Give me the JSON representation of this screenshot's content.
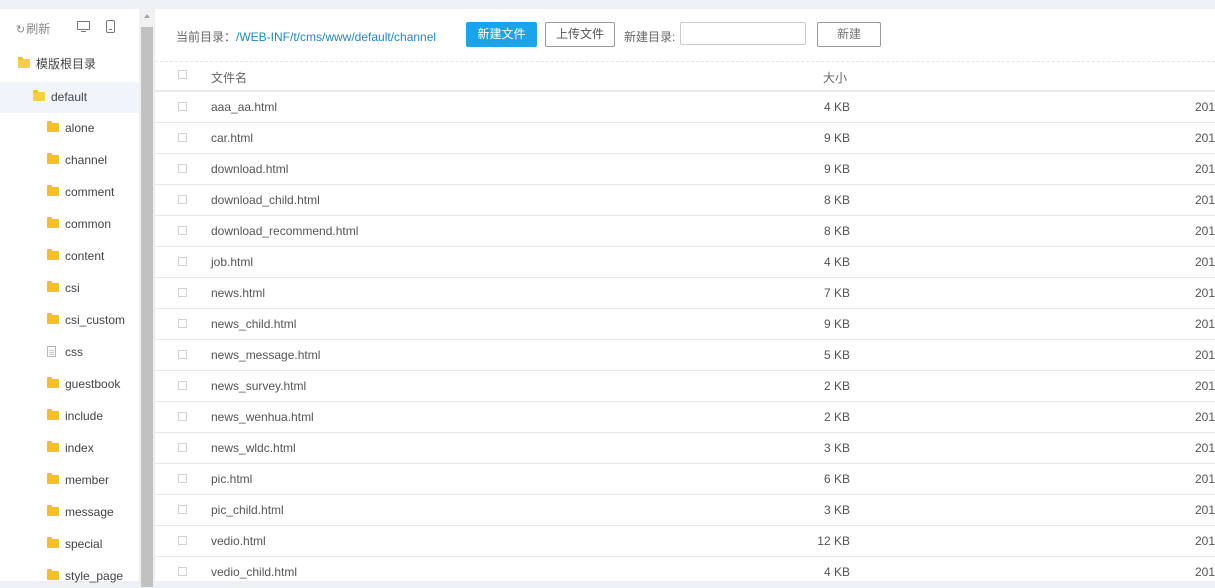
{
  "sidebar": {
    "refresh_label": "刷新",
    "root_label": "模版根目录",
    "selected_label": "default",
    "items": [
      {
        "label": "alone",
        "icon": "folder"
      },
      {
        "label": "channel",
        "icon": "folder"
      },
      {
        "label": "comment",
        "icon": "folder"
      },
      {
        "label": "common",
        "icon": "folder"
      },
      {
        "label": "content",
        "icon": "folder"
      },
      {
        "label": "csi",
        "icon": "folder"
      },
      {
        "label": "csi_custom",
        "icon": "folder"
      },
      {
        "label": "css",
        "icon": "file"
      },
      {
        "label": "guestbook",
        "icon": "folder"
      },
      {
        "label": "include",
        "icon": "folder"
      },
      {
        "label": "index",
        "icon": "folder"
      },
      {
        "label": "member",
        "icon": "folder"
      },
      {
        "label": "message",
        "icon": "folder"
      },
      {
        "label": "special",
        "icon": "folder"
      },
      {
        "label": "style_page",
        "icon": "folder"
      }
    ]
  },
  "toolbar": {
    "current_dir_label": "当前目录：",
    "current_dir_path": "/WEB-INF/t/cms/www/default/channel",
    "new_file_label": "新建文件",
    "upload_label": "上传文件",
    "new_dir_label": "新建目录:",
    "new_dir_value": "",
    "create_label": "新建"
  },
  "table": {
    "col_name": "文件名",
    "col_size": "大小",
    "rows": [
      {
        "name": "aaa_aa.html",
        "size": "4 KB",
        "date": "201"
      },
      {
        "name": "car.html",
        "size": "9 KB",
        "date": "201"
      },
      {
        "name": "download.html",
        "size": "9 KB",
        "date": "201"
      },
      {
        "name": "download_child.html",
        "size": "8 KB",
        "date": "201"
      },
      {
        "name": "download_recommend.html",
        "size": "8 KB",
        "date": "201"
      },
      {
        "name": "job.html",
        "size": "4 KB",
        "date": "201"
      },
      {
        "name": "news.html",
        "size": "7 KB",
        "date": "201"
      },
      {
        "name": "news_child.html",
        "size": "9 KB",
        "date": "201"
      },
      {
        "name": "news_message.html",
        "size": "5 KB",
        "date": "201"
      },
      {
        "name": "news_survey.html",
        "size": "2 KB",
        "date": "201"
      },
      {
        "name": "news_wenhua.html",
        "size": "2 KB",
        "date": "201"
      },
      {
        "name": "news_wldc.html",
        "size": "3 KB",
        "date": "201"
      },
      {
        "name": "pic.html",
        "size": "6 KB",
        "date": "201"
      },
      {
        "name": "pic_child.html",
        "size": "3 KB",
        "date": "201"
      },
      {
        "name": "vedio.html",
        "size": "12 KB",
        "date": "201"
      },
      {
        "name": "vedio_child.html",
        "size": "4 KB",
        "date": "201"
      }
    ]
  },
  "colors": {
    "accent": "#1aa5ea",
    "path_link": "#1e88c8",
    "folder": "#f4c022"
  }
}
